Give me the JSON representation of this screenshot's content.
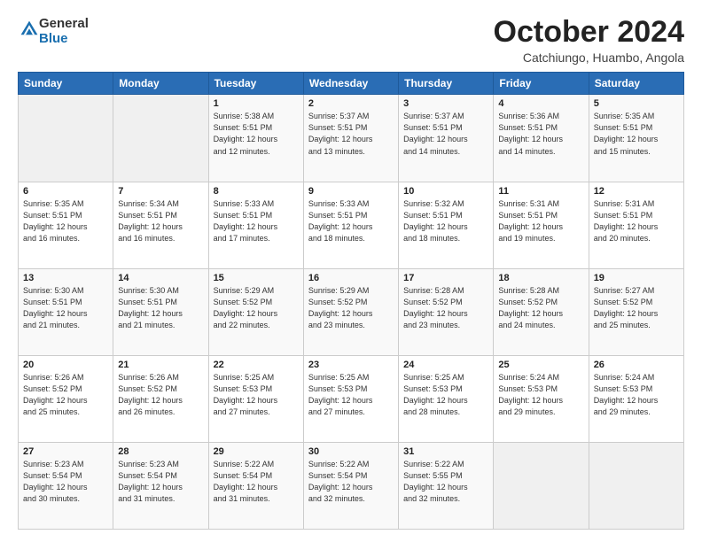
{
  "logo": {
    "general": "General",
    "blue": "Blue"
  },
  "header": {
    "month": "October 2024",
    "location": "Catchiungo, Huambo, Angola"
  },
  "weekdays": [
    "Sunday",
    "Monday",
    "Tuesday",
    "Wednesday",
    "Thursday",
    "Friday",
    "Saturday"
  ],
  "weeks": [
    [
      {
        "day": "",
        "info": ""
      },
      {
        "day": "",
        "info": ""
      },
      {
        "day": "1",
        "info": "Sunrise: 5:38 AM\nSunset: 5:51 PM\nDaylight: 12 hours\nand 12 minutes."
      },
      {
        "day": "2",
        "info": "Sunrise: 5:37 AM\nSunset: 5:51 PM\nDaylight: 12 hours\nand 13 minutes."
      },
      {
        "day": "3",
        "info": "Sunrise: 5:37 AM\nSunset: 5:51 PM\nDaylight: 12 hours\nand 14 minutes."
      },
      {
        "day": "4",
        "info": "Sunrise: 5:36 AM\nSunset: 5:51 PM\nDaylight: 12 hours\nand 14 minutes."
      },
      {
        "day": "5",
        "info": "Sunrise: 5:35 AM\nSunset: 5:51 PM\nDaylight: 12 hours\nand 15 minutes."
      }
    ],
    [
      {
        "day": "6",
        "info": "Sunrise: 5:35 AM\nSunset: 5:51 PM\nDaylight: 12 hours\nand 16 minutes."
      },
      {
        "day": "7",
        "info": "Sunrise: 5:34 AM\nSunset: 5:51 PM\nDaylight: 12 hours\nand 16 minutes."
      },
      {
        "day": "8",
        "info": "Sunrise: 5:33 AM\nSunset: 5:51 PM\nDaylight: 12 hours\nand 17 minutes."
      },
      {
        "day": "9",
        "info": "Sunrise: 5:33 AM\nSunset: 5:51 PM\nDaylight: 12 hours\nand 18 minutes."
      },
      {
        "day": "10",
        "info": "Sunrise: 5:32 AM\nSunset: 5:51 PM\nDaylight: 12 hours\nand 18 minutes."
      },
      {
        "day": "11",
        "info": "Sunrise: 5:31 AM\nSunset: 5:51 PM\nDaylight: 12 hours\nand 19 minutes."
      },
      {
        "day": "12",
        "info": "Sunrise: 5:31 AM\nSunset: 5:51 PM\nDaylight: 12 hours\nand 20 minutes."
      }
    ],
    [
      {
        "day": "13",
        "info": "Sunrise: 5:30 AM\nSunset: 5:51 PM\nDaylight: 12 hours\nand 21 minutes."
      },
      {
        "day": "14",
        "info": "Sunrise: 5:30 AM\nSunset: 5:51 PM\nDaylight: 12 hours\nand 21 minutes."
      },
      {
        "day": "15",
        "info": "Sunrise: 5:29 AM\nSunset: 5:52 PM\nDaylight: 12 hours\nand 22 minutes."
      },
      {
        "day": "16",
        "info": "Sunrise: 5:29 AM\nSunset: 5:52 PM\nDaylight: 12 hours\nand 23 minutes."
      },
      {
        "day": "17",
        "info": "Sunrise: 5:28 AM\nSunset: 5:52 PM\nDaylight: 12 hours\nand 23 minutes."
      },
      {
        "day": "18",
        "info": "Sunrise: 5:28 AM\nSunset: 5:52 PM\nDaylight: 12 hours\nand 24 minutes."
      },
      {
        "day": "19",
        "info": "Sunrise: 5:27 AM\nSunset: 5:52 PM\nDaylight: 12 hours\nand 25 minutes."
      }
    ],
    [
      {
        "day": "20",
        "info": "Sunrise: 5:26 AM\nSunset: 5:52 PM\nDaylight: 12 hours\nand 25 minutes."
      },
      {
        "day": "21",
        "info": "Sunrise: 5:26 AM\nSunset: 5:52 PM\nDaylight: 12 hours\nand 26 minutes."
      },
      {
        "day": "22",
        "info": "Sunrise: 5:25 AM\nSunset: 5:53 PM\nDaylight: 12 hours\nand 27 minutes."
      },
      {
        "day": "23",
        "info": "Sunrise: 5:25 AM\nSunset: 5:53 PM\nDaylight: 12 hours\nand 27 minutes."
      },
      {
        "day": "24",
        "info": "Sunrise: 5:25 AM\nSunset: 5:53 PM\nDaylight: 12 hours\nand 28 minutes."
      },
      {
        "day": "25",
        "info": "Sunrise: 5:24 AM\nSunset: 5:53 PM\nDaylight: 12 hours\nand 29 minutes."
      },
      {
        "day": "26",
        "info": "Sunrise: 5:24 AM\nSunset: 5:53 PM\nDaylight: 12 hours\nand 29 minutes."
      }
    ],
    [
      {
        "day": "27",
        "info": "Sunrise: 5:23 AM\nSunset: 5:54 PM\nDaylight: 12 hours\nand 30 minutes."
      },
      {
        "day": "28",
        "info": "Sunrise: 5:23 AM\nSunset: 5:54 PM\nDaylight: 12 hours\nand 31 minutes."
      },
      {
        "day": "29",
        "info": "Sunrise: 5:22 AM\nSunset: 5:54 PM\nDaylight: 12 hours\nand 31 minutes."
      },
      {
        "day": "30",
        "info": "Sunrise: 5:22 AM\nSunset: 5:54 PM\nDaylight: 12 hours\nand 32 minutes."
      },
      {
        "day": "31",
        "info": "Sunrise: 5:22 AM\nSunset: 5:55 PM\nDaylight: 12 hours\nand 32 minutes."
      },
      {
        "day": "",
        "info": ""
      },
      {
        "day": "",
        "info": ""
      }
    ]
  ]
}
